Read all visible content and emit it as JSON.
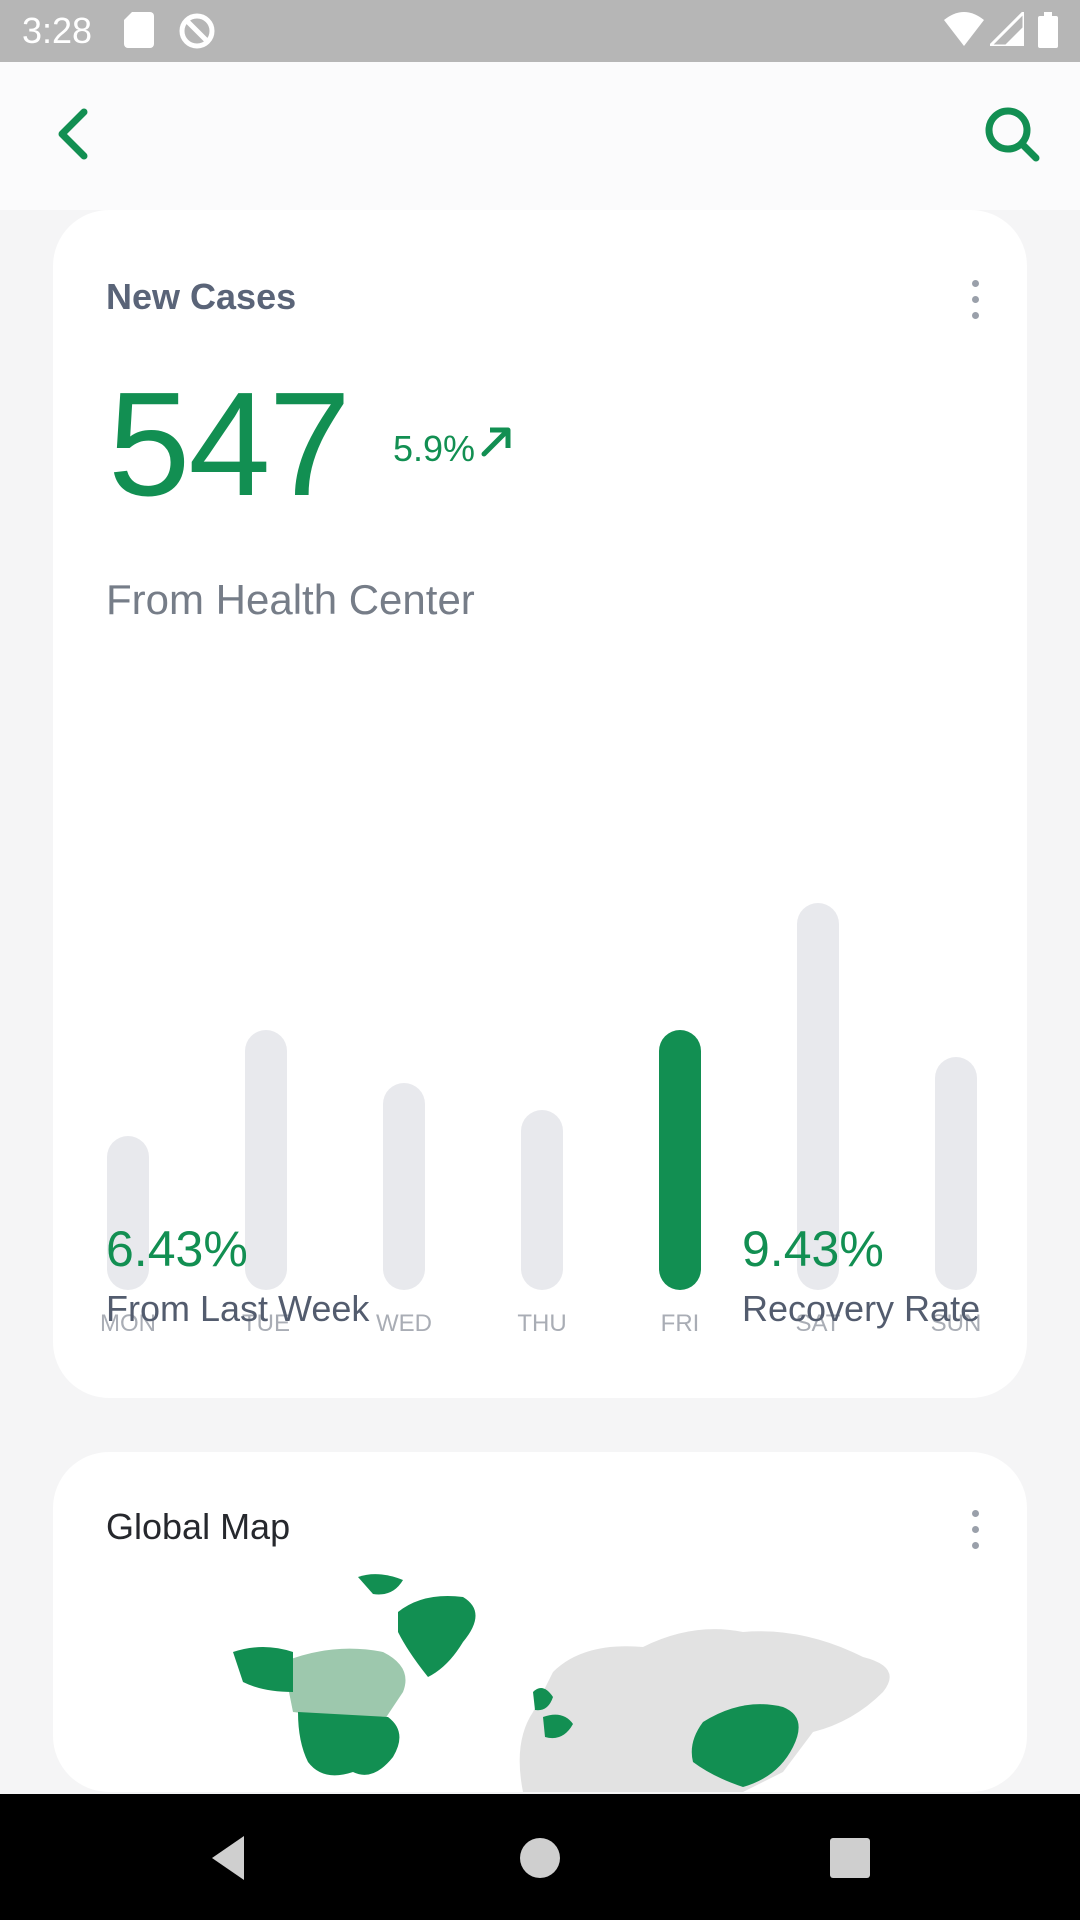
{
  "status_bar": {
    "time": "3:28",
    "icons": [
      "sd-card-icon",
      "sync-icon",
      "wifi-icon",
      "signal-icon",
      "battery-icon"
    ]
  },
  "app_bar": {
    "back_icon": "chevron-left-icon",
    "search_icon": "search-icon",
    "accent_color": "#128f52"
  },
  "new_cases_card": {
    "title": "New Cases",
    "menu_icon": "more-vertical-icon",
    "count": "547",
    "change": "5.9%",
    "trend_icon": "arrow-up-right-icon",
    "subtitle": "From Health Center",
    "stats": [
      {
        "value": "6.43%",
        "label": "From Last Week"
      },
      {
        "value": "9.43%",
        "label": "Recovery Rate"
      }
    ]
  },
  "chart_data": {
    "type": "bar",
    "categories": [
      "MON",
      "TUE",
      "WED",
      "THU",
      "FRI",
      "SAT",
      "SUN"
    ],
    "values": [
      35,
      59,
      47,
      41,
      59,
      88,
      53
    ],
    "highlighted": "FRI",
    "highlight_color": "#128f52",
    "bar_color": "#e8e9ed",
    "grid": false
  },
  "global_map_card": {
    "title": "Global Map",
    "menu_icon": "more-vertical-icon",
    "map_icon": "world-map-icon"
  },
  "nav_bar": {
    "icons": [
      "back-triangle-icon",
      "home-circle-icon",
      "recents-square-icon"
    ]
  }
}
